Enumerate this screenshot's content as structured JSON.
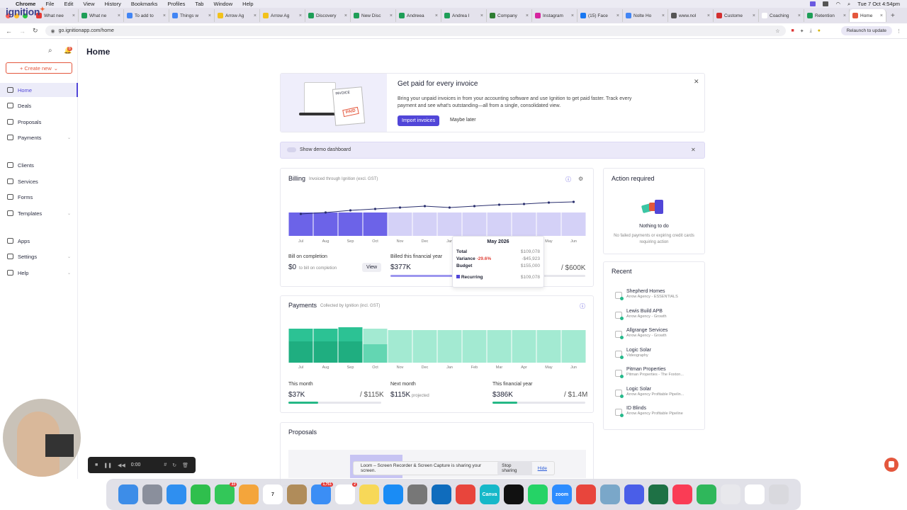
{
  "menubar": {
    "items": [
      "Chrome",
      "File",
      "Edit",
      "View",
      "History",
      "Bookmarks",
      "Profiles",
      "Tab",
      "Window",
      "Help"
    ],
    "clock": "Tue 7 Oct  4:54pm"
  },
  "tabs": [
    {
      "label": "What nee",
      "color": "#e53935"
    },
    {
      "label": "What ne",
      "color": "#1e9e57"
    },
    {
      "label": "To add to",
      "color": "#4285f4"
    },
    {
      "label": "Things w",
      "color": "#4285f4"
    },
    {
      "label": "Arrow Ag",
      "color": "#f2c21b"
    },
    {
      "label": "Arrow Ag",
      "color": "#f2c21b"
    },
    {
      "label": "Discovery",
      "color": "#1e9e57"
    },
    {
      "label": "New Disc",
      "color": "#1e9e57"
    },
    {
      "label": "Andreea",
      "color": "#1e9e57"
    },
    {
      "label": "Andrea I",
      "color": "#1e9e57"
    },
    {
      "label": "Company",
      "color": "#2e7d32"
    },
    {
      "label": "Instagram",
      "color": "#d6249f"
    },
    {
      "label": "(15) Face",
      "color": "#1877f2"
    },
    {
      "label": "Nolte Ho",
      "color": "#4285f4"
    },
    {
      "label": "www.nol",
      "color": "#555555"
    },
    {
      "label": "Custome",
      "color": "#d32f2f"
    },
    {
      "label": "Coaching",
      "color": "#ffffff"
    },
    {
      "label": "Retention",
      "color": "#1e9e57"
    },
    {
      "label": "Home",
      "color": "#e4573d",
      "active": true
    }
  ],
  "address": {
    "url": "go.ignitionapp.com/home",
    "relaunch": "Relaunch to update"
  },
  "sidebar": {
    "logo": "ignition",
    "notif_count": "8",
    "create": "+ Create new",
    "items": [
      {
        "label": "Home",
        "active": true
      },
      {
        "label": "Deals"
      },
      {
        "label": "Proposals"
      },
      {
        "label": "Payments",
        "chev": true
      },
      {
        "label": "Clients"
      },
      {
        "label": "Services"
      },
      {
        "label": "Forms"
      },
      {
        "label": "Templates",
        "chev": true
      },
      {
        "label": "Apps"
      },
      {
        "label": "Settings",
        "chev": true
      },
      {
        "label": "Help",
        "chev": true
      }
    ]
  },
  "page": {
    "title": "Home"
  },
  "banner": {
    "title": "Get paid for every invoice",
    "body": "Bring your unpaid invoices in from your accounting software and use Ignition to get paid faster. Track every payment and see what's outstanding—all from a single, consolidated view.",
    "primary": "Import invoices",
    "secondary": "Maybe later",
    "img_invoice": "INVOICE",
    "img_paid": "PAID"
  },
  "demo": {
    "label": "Show demo dashboard"
  },
  "billing": {
    "title": "Billing",
    "subtitle": "Invoiced through Ignition (excl. GST)",
    "months": [
      "Jul",
      "Aug",
      "Sep",
      "Oct",
      "Nov",
      "Dec",
      "Jan",
      "Feb",
      "Mar",
      "Apr",
      "May",
      "Jun"
    ],
    "bill_on_completion": {
      "label": "Bill on completion",
      "value": "$0",
      "sub": "to bill on completion",
      "view": "View"
    },
    "fy": {
      "label": "Billed this financial year",
      "value": "$377K",
      "target": "/ $600K",
      "progress": 0.63
    },
    "tooltip": {
      "title": "May 2026",
      "total_label": "Total",
      "total": "$109,078",
      "variance_label": "Variance",
      "variance_pct": "-29.6%",
      "variance": "-$45,923",
      "budget_label": "Budget",
      "budget": "$155,000",
      "recurring_label": "Recurring",
      "recurring": "$109,078"
    }
  },
  "payments": {
    "title": "Payments",
    "subtitle": "Collected by Ignition (incl. GST)",
    "months": [
      "Jul",
      "Aug",
      "Sep",
      "Oct",
      "Nov",
      "Dec",
      "Jan",
      "Feb",
      "Mar",
      "Apr",
      "May",
      "Jun"
    ],
    "this_month": {
      "label": "This month",
      "value": "$37K",
      "target": "/ $115K",
      "progress": 0.32
    },
    "next_month": {
      "label": "Next month",
      "value": "$115K",
      "sub": "projected"
    },
    "fy": {
      "label": "This financial year",
      "value": "$386K",
      "target": "/ $1.4M",
      "progress": 0.27
    }
  },
  "proposals": {
    "title": "Proposals"
  },
  "action": {
    "title": "Action required",
    "nothing": "Nothing to do",
    "desc": "No failed payments or expiring credit cards requiring action"
  },
  "recent": {
    "title": "Recent",
    "items": [
      {
        "name": "Shepherd Homes",
        "sub": "Arrow Agency - ESSENTIALS"
      },
      {
        "name": "Lewis Build APB",
        "sub": "Arrow Agency - Growth"
      },
      {
        "name": "Allgrange Services",
        "sub": "Arrow Agency - Growth"
      },
      {
        "name": "Logic Solar",
        "sub": "Videography"
      },
      {
        "name": "Pitman Properties",
        "sub": "Pitman Properties - The Foxton..."
      },
      {
        "name": "Logic Solar",
        "sub": "Arrow Agency Profitable Pipelin..."
      },
      {
        "name": "ID Blinds",
        "sub": "Arrow Agency Profitable Pipeline"
      }
    ]
  },
  "loom": {
    "text": "Loom – Screen Recorder & Screen Capture is sharing your screen.",
    "stop": "Stop sharing",
    "hide": "Hide"
  },
  "recorder": {
    "time": "0:00"
  },
  "dock": [
    {
      "name": "finder",
      "color": "#3d8de8",
      "label": ""
    },
    {
      "name": "launchpad",
      "color": "#8a8f9c",
      "label": ""
    },
    {
      "name": "safari",
      "color": "#2f8ff0",
      "label": ""
    },
    {
      "name": "facetime",
      "color": "#2fbf4d",
      "label": ""
    },
    {
      "name": "messages",
      "color": "#33c759",
      "label": "",
      "badge": "33"
    },
    {
      "name": "photos",
      "color": "#f4a53b",
      "label": ""
    },
    {
      "name": "calendar",
      "color": "#ffffff",
      "label": "7"
    },
    {
      "name": "contacts",
      "color": "#b08c5a",
      "label": ""
    },
    {
      "name": "mail",
      "color": "#3b8ef5",
      "label": "",
      "badge": "1,751"
    },
    {
      "name": "reminders",
      "color": "#ffffff",
      "label": "",
      "badge": "2"
    },
    {
      "name": "notes",
      "color": "#f7d858",
      "label": ""
    },
    {
      "name": "app-store",
      "color": "#1a8cf5",
      "label": ""
    },
    {
      "name": "system-settings",
      "color": "#777777",
      "label": ""
    },
    {
      "name": "outlook",
      "color": "#0f6cbd",
      "label": ""
    },
    {
      "name": "chrome",
      "color": "#e8453c",
      "label": ""
    },
    {
      "name": "canva",
      "color": "#16b8c9",
      "label": "Canva"
    },
    {
      "name": "capcut",
      "color": "#111111",
      "label": ""
    },
    {
      "name": "whatsapp",
      "color": "#25d366",
      "label": ""
    },
    {
      "name": "zoom",
      "color": "#2d8cff",
      "label": "zoom"
    },
    {
      "name": "craft",
      "color": "#e8453c",
      "label": ""
    },
    {
      "name": "preview",
      "color": "#7aa7c9",
      "label": ""
    },
    {
      "name": "perplexity",
      "color": "#4a5ee8",
      "label": ""
    },
    {
      "name": "excel",
      "color": "#1e7145",
      "label": ""
    },
    {
      "name": "music",
      "color": "#fa3c55",
      "label": ""
    },
    {
      "name": "numbers",
      "color": "#2fb75b",
      "label": ""
    },
    {
      "name": "downloads",
      "color": "#e8e8ec",
      "label": ""
    },
    {
      "name": "screens",
      "color": "#ffffff",
      "label": ""
    },
    {
      "name": "trash",
      "color": "#d9d9de",
      "label": ""
    }
  ],
  "colors": {
    "accent": "#5146d8",
    "billing_bar": "#6c63e8",
    "billing_light": "#d4d1f7",
    "pay_dark": "#25b886",
    "pay_light": "#a3ead2",
    "orange": "#e4573d"
  }
}
